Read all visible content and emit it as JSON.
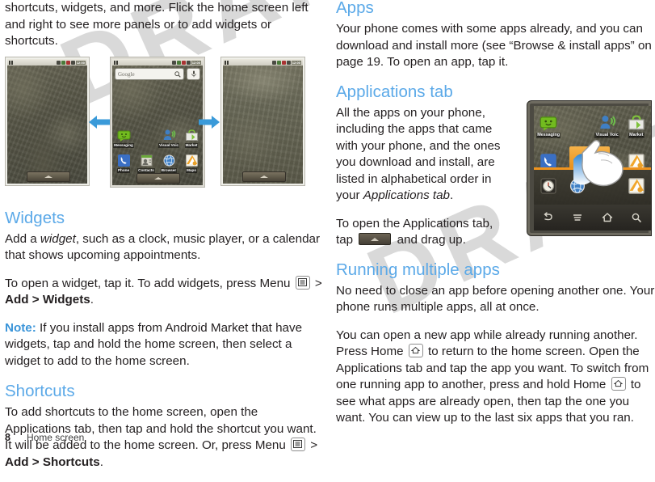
{
  "document": {
    "page_number": "8",
    "chapter": "Home screen",
    "watermark": "DRAFT"
  },
  "left_column": {
    "intro_paragraph": "shortcuts, widgets, and more. Flick the home screen left and right to see more panels or to add widgets or shortcuts.",
    "widgets": {
      "heading": "Widgets",
      "p1_a": "Add a ",
      "p1_italic": "widget",
      "p1_b": ", such as a clock, music player, or a calendar that shows upcoming appointments.",
      "p2_a": "To open a widget, tap it. To add widgets, press Menu ",
      "p2_b": " > ",
      "p2_bold": "Add > Widgets",
      "p2_c": ".",
      "note_label": "Note:",
      "note_text": " If you install apps from Android Market that have widgets, tap and hold the home screen, then select a widget to add to the home screen."
    },
    "shortcuts": {
      "heading": "Shortcuts",
      "p1_a": "To add shortcuts to the home screen, open the Applications tab, then tap and hold the shortcut you want. It will be added to the home screen. Or, press Menu ",
      "p1_b": " > ",
      "p1_bold": "Add > Shortcuts",
      "p1_c": "."
    }
  },
  "right_column": {
    "apps": {
      "heading": "Apps",
      "paragraph": "Your phone comes with some apps already, and you can download and install more (see “Browse & install apps” on page 19. To open an app, tap it."
    },
    "applications_tab": {
      "heading": "Applications tab",
      "p1_a": "All the apps on your phone, including the apps that came with your phone, and the ones you download and install, are listed in alphabetical order in your ",
      "p1_italic": "Applications tab",
      "p1_b": ".",
      "p2_a": "To open the Applications tab, tap ",
      "p2_b": " and drag up."
    },
    "running_multiple": {
      "heading": "Running multiple apps",
      "p1": "No need to close an app before opening another one. Your phone runs multiple apps, all at once.",
      "p2_a": "You can open a new app while already running another. Press Home ",
      "p2_b": " to return to the home screen. Open the Applications tab and tap the app you want. To switch from one running app to another, press and hold Home ",
      "p2_c": " to see what apps are already open, then tap the one you want. You can view up to the last six apps that you ran."
    }
  },
  "figure_three_phones": {
    "caption_icons": [
      "arrow-left",
      "arrow-right"
    ],
    "phones": [
      {
        "name": "home-panel-left",
        "has_widgets": false
      },
      {
        "name": "home-panel-center",
        "search_widget": {
          "placeholder": "Google",
          "icons": [
            "search-icon",
            "microphone-icon"
          ]
        },
        "row1": [
          {
            "label": "Messaging",
            "icon": "messaging-icon"
          },
          {
            "label": "",
            "icon": ""
          },
          {
            "label": "Visual Voic",
            "icon": "visual-voicemail-icon"
          },
          {
            "label": "Market",
            "icon": "market-icon"
          }
        ],
        "row2": [
          {
            "label": "Phone",
            "icon": "phone-icon"
          },
          {
            "label": "Contacts",
            "icon": "contacts-icon"
          },
          {
            "label": "Browser",
            "icon": "browser-icon"
          },
          {
            "label": "Maps",
            "icon": "maps-icon"
          }
        ]
      },
      {
        "name": "home-panel-right",
        "has_widgets": false
      }
    ],
    "status_bar_time": "12:00"
  },
  "figure_big_phone": {
    "row1": [
      {
        "label": "Messaging",
        "icon": "messaging-icon"
      },
      {
        "label": "",
        "icon": ""
      },
      {
        "label": "Visual Voic",
        "icon": "visual-voicemail-icon"
      },
      {
        "label": "Market",
        "icon": "market-icon"
      }
    ],
    "row2": [
      {
        "label": "",
        "icon": "phone-icon"
      },
      {
        "label": "",
        "icon": "contacts-icon"
      },
      {
        "label": "",
        "icon": "browser-icon"
      },
      {
        "label": "",
        "icon": "maps-icon"
      }
    ],
    "row3": [
      {
        "label": "",
        "icon": "clock-icon"
      },
      {
        "label": "",
        "icon": "browser-icon"
      },
      {
        "label": "",
        "icon": ""
      },
      {
        "label": "",
        "icon": "maps-icon"
      }
    ],
    "nav_buttons": [
      "back-icon",
      "menu-icon",
      "home-icon",
      "search-icon"
    ],
    "gesture": "drag-up-hand"
  },
  "colors": {
    "heading_blue": "#5ba9e8",
    "note_blue": "#3b95d9",
    "body": "#231f20",
    "watermark": "#d9d9d9",
    "accent_orange": "#f0941e",
    "arrow_blue": "#3a9ad9"
  }
}
